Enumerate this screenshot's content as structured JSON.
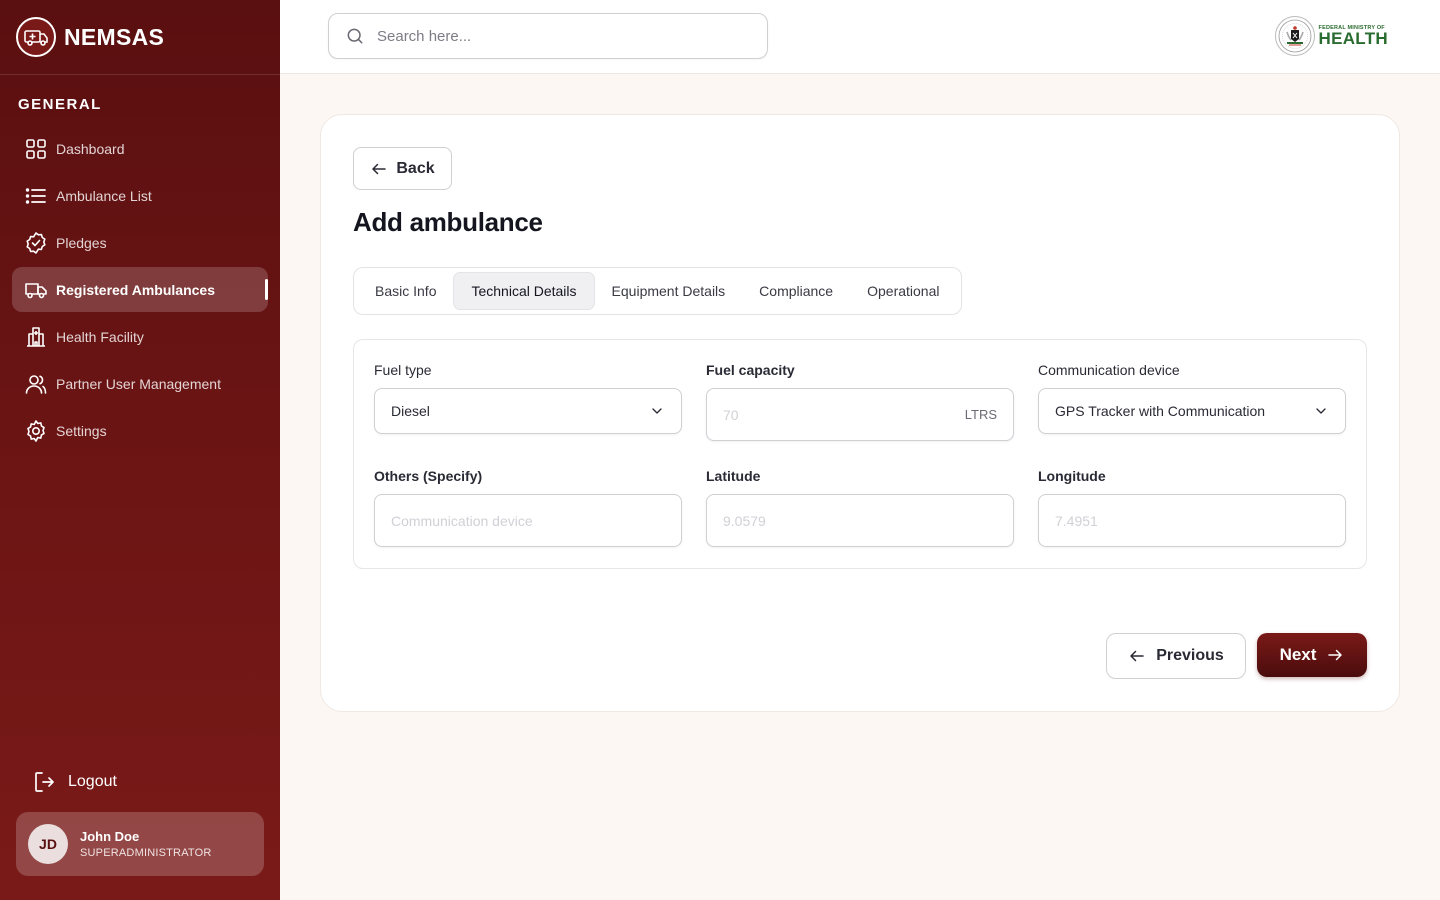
{
  "app": {
    "name": "NEMSAS"
  },
  "sidebar": {
    "section_label": "GENERAL",
    "items": [
      {
        "label": "Dashboard",
        "icon": "grid-icon"
      },
      {
        "label": "Ambulance List",
        "icon": "list-icon"
      },
      {
        "label": "Pledges",
        "icon": "badge-check-icon"
      },
      {
        "label": "Registered Ambulances",
        "icon": "truck-icon",
        "active": true
      },
      {
        "label": "Health Facility",
        "icon": "hospital-icon"
      },
      {
        "label": "Partner User Management",
        "icon": "users-icon"
      },
      {
        "label": "Settings",
        "icon": "gear-icon"
      }
    ],
    "logout_label": "Logout",
    "user": {
      "initials": "JD",
      "name": "John Doe",
      "role": "SUPERADMINISTRATOR"
    }
  },
  "header": {
    "search_placeholder": "Search here...",
    "ministry_small": "FEDERAL MINISTRY OF",
    "ministry_big": "HEALTH"
  },
  "page": {
    "back_label": "Back",
    "title": "Add ambulance",
    "tabs": [
      "Basic Info",
      "Technical Details",
      "Equipment Details",
      "Compliance",
      "Operational"
    ],
    "active_tab": "Technical Details"
  },
  "form": {
    "fuel_type": {
      "label": "Fuel type",
      "value": "Diesel"
    },
    "fuel_capacity": {
      "label": "Fuel capacity",
      "placeholder": "70",
      "suffix": "LTRS"
    },
    "communication_device": {
      "label": "Communication device",
      "value": "GPS Tracker with Communication"
    },
    "others": {
      "label": "Others (Specify)",
      "placeholder": "Communication device"
    },
    "latitude": {
      "label": "Latitude",
      "placeholder": "9.0579"
    },
    "longitude": {
      "label": "Longitude",
      "placeholder": "7.4951"
    }
  },
  "actions": {
    "previous_label": "Previous",
    "next_label": "Next"
  },
  "colors": {
    "brand": "#6a1414",
    "brand_dark": "#4a0c0c",
    "background": "#fcf7f3",
    "ministry_green": "#2a6b2f"
  }
}
